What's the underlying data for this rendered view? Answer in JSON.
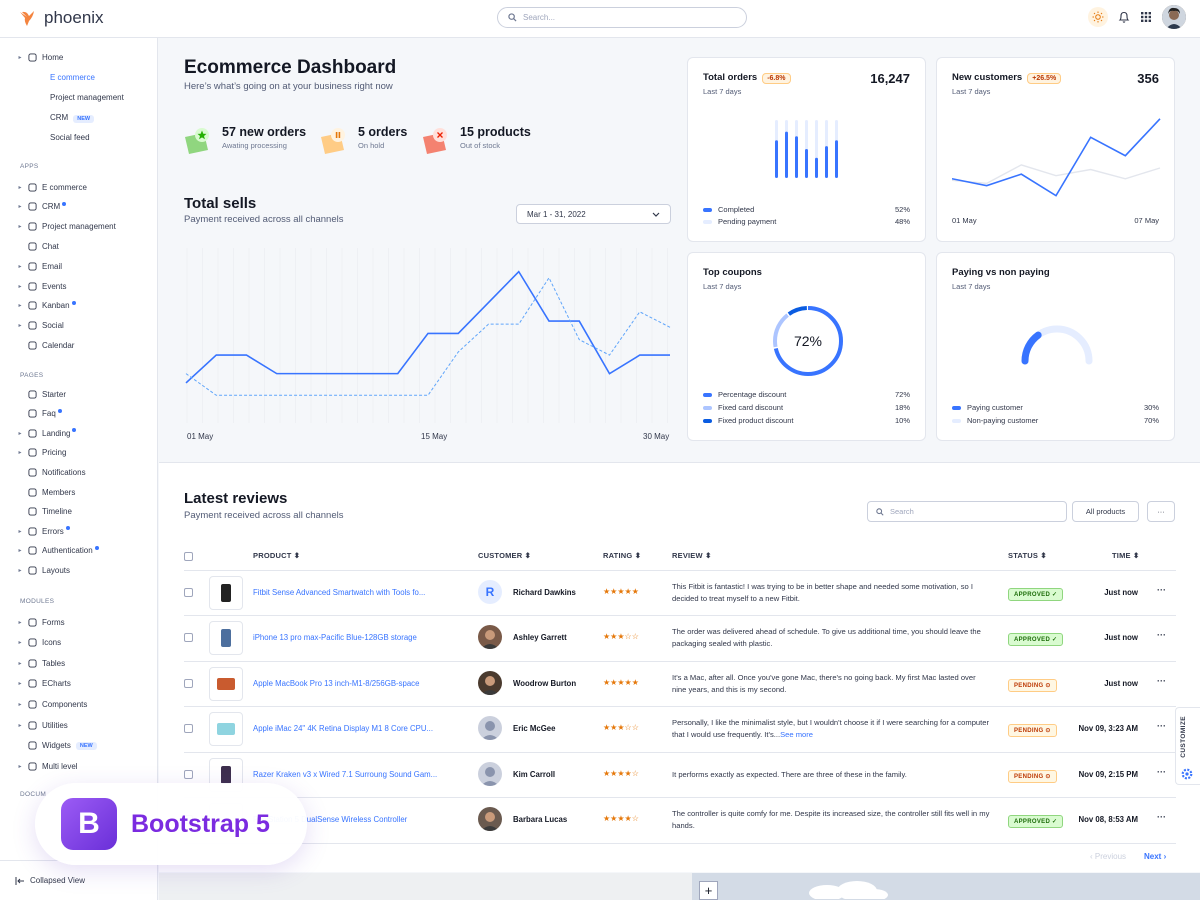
{
  "app": {
    "name": "phoenix"
  },
  "topbar": {
    "search_placeholder": "Search..."
  },
  "sidebar": {
    "home": "Home",
    "home_sub": [
      "E commerce",
      "Project management",
      "CRM",
      "Social feed"
    ],
    "new_badge": "NEW",
    "apps_head": "APPS",
    "apps": [
      "E commerce",
      "CRM",
      "Project management",
      "Chat",
      "Email",
      "Events",
      "Kanban",
      "Social",
      "Calendar"
    ],
    "pages_head": "PAGES",
    "pages": [
      "Starter",
      "Faq",
      "Landing",
      "Pricing",
      "Notifications",
      "Members",
      "Timeline",
      "Errors",
      "Authentication",
      "Layouts"
    ],
    "modules_head": "MODULES",
    "modules": [
      "Forms",
      "Icons",
      "Tables",
      "ECharts",
      "Components",
      "Utilities",
      "Widgets",
      "Multi level"
    ],
    "docs_head": "DOCUM",
    "collapsed": "Collapsed View"
  },
  "dashboard": {
    "title": "Ecommerce Dashboard",
    "subtitle": "Here’s what’s going on at your business right now",
    "stats": [
      {
        "value": "57 new orders",
        "label": "Awating processing"
      },
      {
        "value": "5 orders",
        "label": "On hold"
      },
      {
        "value": "15 products",
        "label": "Out of stock"
      }
    ],
    "sells_title": "Total sells",
    "sells_sub": "Payment received across all channels",
    "date_range": "Mar 1 - 31, 2022",
    "x_labels": [
      "01 May",
      "15 May",
      "30 May"
    ]
  },
  "chart_data": {
    "type": "line",
    "series": [
      {
        "values": [
          1.2,
          2.1,
          2.1,
          1.5,
          1.5,
          1.5,
          1.5,
          1.5,
          2.8,
          2.8,
          3.8,
          4.8,
          3.2,
          3.2,
          1.5,
          2.1,
          2.1
        ]
      },
      {
        "values": [
          1.5,
          0.8,
          0.8,
          0.8,
          0.8,
          0.8,
          0.8,
          0.8,
          0.8,
          2.2,
          3.1,
          3.1,
          4.6,
          2.6,
          2.1,
          3.5,
          3.0
        ]
      }
    ]
  },
  "cards": {
    "total_orders": {
      "title": "Total orders",
      "pill": "-6.8%",
      "value": "16,247",
      "period": "Last 7 days",
      "legend": [
        {
          "label": "Completed",
          "pct": "52%"
        },
        {
          "label": "Pending payment",
          "pct": "48%"
        }
      ],
      "completed": [
        0.65,
        0.8,
        0.72,
        0.5,
        0.35,
        0.55,
        0.65
      ],
      "pending": [
        1,
        1,
        1,
        1,
        1,
        1,
        1
      ]
    },
    "new_customers": {
      "title": "New customers",
      "pill": "+26.5%",
      "value": "356",
      "period": "Last 7 days",
      "x_start": "01 May",
      "x_end": "07 May",
      "series": [
        [
          42,
          33,
          48,
          20,
          96,
          72,
          120
        ],
        [
          40,
          36,
          60,
          46,
          54,
          42,
          56
        ]
      ]
    },
    "top_coupons": {
      "title": "Top coupons",
      "period": "Last 7 days",
      "center": "72%",
      "legend": [
        {
          "label": "Percentage discount",
          "pct": "72%",
          "color": "#3874ff"
        },
        {
          "label": "Fixed card discount",
          "pct": "18%",
          "color": "#adc5ff"
        },
        {
          "label": "Fixed product discount",
          "pct": "10%",
          "color": "#0a5ce1"
        }
      ],
      "slices": [
        72,
        18,
        10
      ]
    },
    "paying": {
      "title": "Paying vs non paying",
      "period": "Last 7 days",
      "legend": [
        {
          "label": "Paying customer",
          "pct": "30%",
          "color": "#3874ff"
        },
        {
          "label": "Non-paying customer",
          "pct": "70%",
          "color": "#e5edff"
        }
      ],
      "paying_fraction": 0.3
    }
  },
  "reviews": {
    "title": "Latest reviews",
    "subtitle": "Payment received across all channels",
    "search_placeholder": "Search",
    "filter": "All products",
    "more": "···",
    "headers": {
      "product": "PRODUCT",
      "customer": "CUSTOMER",
      "rating": "RATING",
      "review": "REVIEW",
      "status": "STATUS",
      "time": "TIME"
    },
    "rows": [
      {
        "product": "Fitbit Sense Advanced Smartwatch with Tools fo...",
        "customer": "Richard Dawkins",
        "initial": "R",
        "stars": "★★★★★",
        "review": "This Fitbit is fantastic! I was trying to be in better shape and needed some motivation, so I decided to treat myself to a new Fitbit.",
        "see": "",
        "status": "APPROVED ✓",
        "time": "Just now"
      },
      {
        "product": "iPhone 13 pro max-Pacific Blue-128GB storage",
        "customer": "Ashley Garrett",
        "initial": "",
        "stars": "★★★☆☆",
        "review": "The order was delivered ahead of schedule. To give us additional time, you should leave the packaging sealed with plastic.",
        "see": "",
        "status": "APPROVED ✓",
        "time": "Just now"
      },
      {
        "product": "Apple MacBook Pro 13 inch-M1-8/256GB-space",
        "customer": "Woodrow Burton",
        "initial": "",
        "stars": "★★★★★",
        "review": "It's a Mac, after all. Once you've gone Mac, there's no going back. My first Mac lasted over nine years, and this is my second.",
        "see": "",
        "status": "PENDING ⊙",
        "time": "Just now"
      },
      {
        "product": "Apple iMac 24\" 4K Retina Display M1 8 Core CPU...",
        "customer": "Eric McGee",
        "initial": "",
        "stars": "★★★☆☆",
        "review": "Personally, I like the minimalist style, but I wouldn't choose it if I were searching for a computer that I would use frequently. It's...",
        "see": "See more",
        "status": "PENDING ⊙",
        "time": "Nov 09, 3:23 AM"
      },
      {
        "product": "Razer Kraken v3 x Wired 7.1 Surroung Sound Gam...",
        "customer": "Kim Carroll",
        "initial": "",
        "stars": "★★★★☆",
        "review": "It performs exactly as expected. There are three of these in the family.",
        "see": "",
        "status": "PENDING ⊙",
        "time": "Nov 09, 2:15 PM"
      },
      {
        "product": "PlayStation 5 DualSense Wireless Controller",
        "customer": "Barbara Lucas",
        "initial": "",
        "stars": "★★★★☆",
        "review": "The controller is quite comfy for me. Despite its increased size, the controller still fits well in my hands.",
        "see": "",
        "status": "APPROVED ✓",
        "time": "Nov 08, 8:53 AM"
      }
    ],
    "previous": "Previous",
    "next": "Next"
  },
  "customize": "CUSTOMIZE",
  "badge": {
    "letter": "B",
    "text": "Bootstrap 5"
  },
  "colors": {
    "primary": "#3874ff",
    "light": "#e5edff",
    "warning": "#e5780b"
  }
}
